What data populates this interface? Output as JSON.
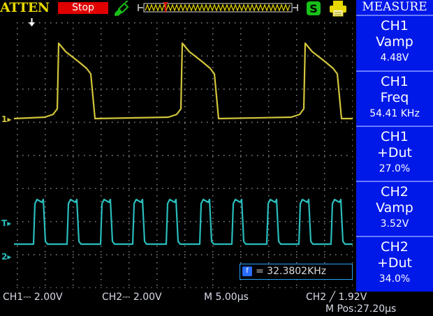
{
  "topbar": {
    "brand": "ATTEN",
    "run_status": "Stop",
    "icons": [
      "probe-icon",
      "trigger-position-icon",
      "usb-icon",
      "printer-icon"
    ]
  },
  "colors": {
    "ch1": "#d2c53c",
    "ch2": "#2abdbd",
    "panel_bg": "#0018e8",
    "stop_bg": "#e00000",
    "grid": "#8a8a8a",
    "brand": "#e8d800"
  },
  "markers": {
    "ch1_level": "1",
    "trigger_level": "T",
    "ch2_level": "2"
  },
  "measure_panel": {
    "title": "MEASURE",
    "items": [
      {
        "channel": "CH1",
        "type": "Vamp",
        "value": "4.48V"
      },
      {
        "channel": "CH1",
        "type": "Freq",
        "value": "54.41 KHz"
      },
      {
        "channel": "CH1",
        "type": "+Dut",
        "value": "27.0%"
      },
      {
        "channel": "CH2",
        "type": "Vamp",
        "value": "3.52V"
      },
      {
        "channel": "CH2",
        "type": "+Dut",
        "value": "34.0%"
      }
    ]
  },
  "counter": {
    "text": "= 32.3802KHz"
  },
  "bottombar": {
    "ch1_scale": "CH1⎓ 2.00V",
    "ch2_scale": "CH2⎓ 2.00V",
    "timebase": "M 5.00μs",
    "trigger": "CH2 ╱ 1.92V",
    "position": "M Pos:27.20μs"
  }
}
